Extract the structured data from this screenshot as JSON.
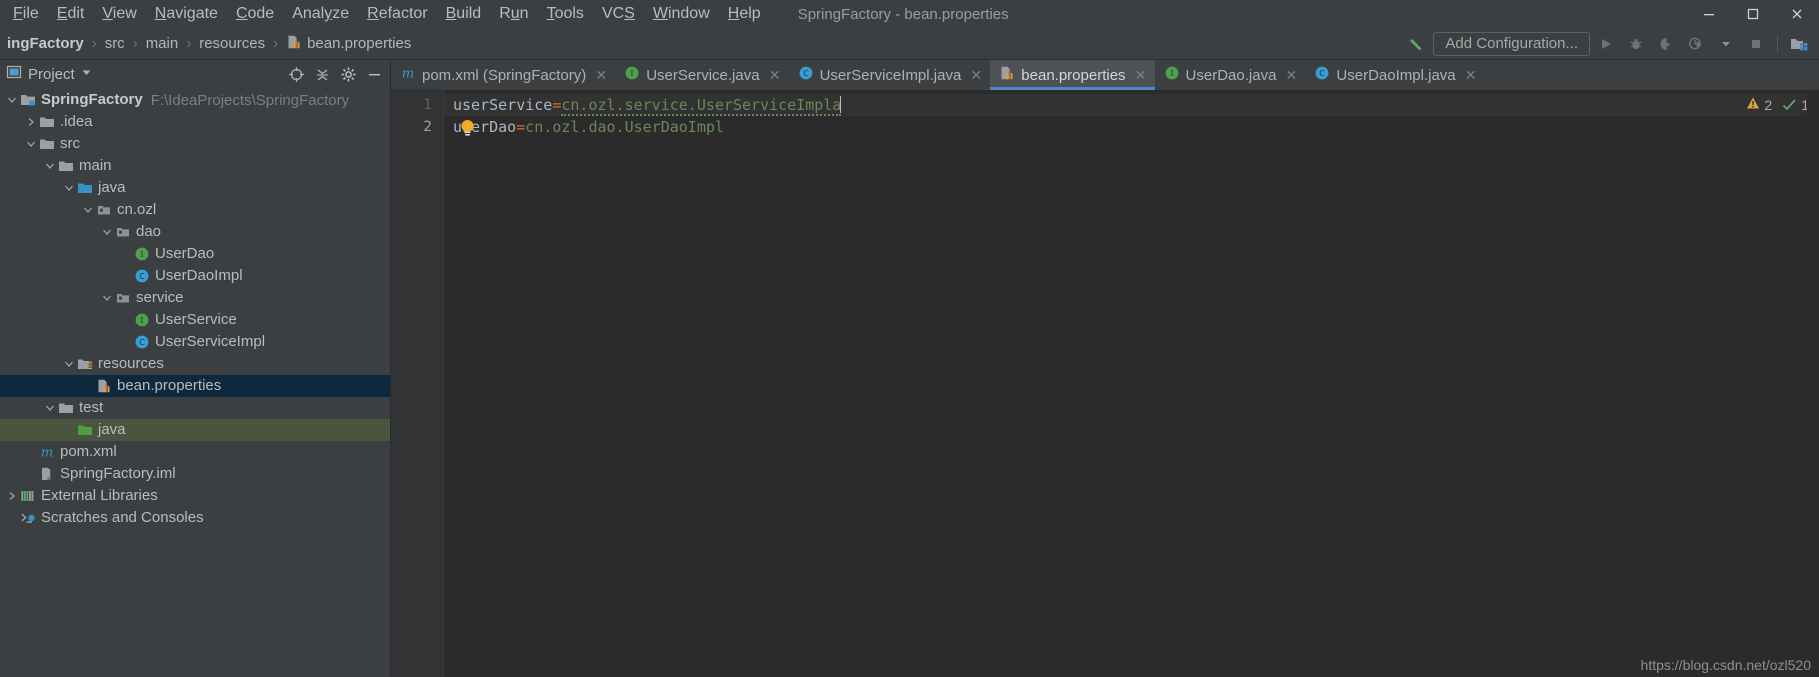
{
  "window": {
    "title": "SpringFactory - bean.properties",
    "menu": [
      "File",
      "Edit",
      "View",
      "Navigate",
      "Code",
      "Analyze",
      "Refactor",
      "Build",
      "Run",
      "Tools",
      "VCS",
      "Window",
      "Help"
    ],
    "controls": [
      "minimize",
      "maximize",
      "close"
    ]
  },
  "navbar": {
    "breadcrumbs": [
      {
        "label": "ingFactory",
        "icon": "",
        "bold": true
      },
      {
        "label": "src",
        "icon": ""
      },
      {
        "label": "main",
        "icon": ""
      },
      {
        "label": "resources",
        "icon": ""
      },
      {
        "label": "bean.properties",
        "icon": "properties-file-icon"
      }
    ],
    "separator": "›",
    "hammer_icon": "build-hammer-icon",
    "add_configuration": "Add Configuration...",
    "right_icons": [
      "run-icon",
      "debug-icon",
      "run-coverage-icon",
      "profiler-icon",
      "dropdown-icon",
      "stop-icon",
      "project-structure-icon"
    ]
  },
  "project_panel": {
    "title": "Project",
    "title_icon": "project-view-icon",
    "dropdown_icon": "chevron-down-icon",
    "header_icons": [
      "locate-target-icon",
      "collapse-all-icon",
      "settings-gear-icon",
      "hide-panel-icon"
    ],
    "tree": [
      {
        "label": "SpringFactory",
        "sublabel": "F:\\IdeaProjects\\SpringFactory",
        "indent": 0,
        "arrow": "down",
        "icon": "module-folder-icon",
        "bold": true,
        "state": "normal"
      },
      {
        "label": ".idea",
        "sublabel": "",
        "indent": 1,
        "arrow": "right",
        "icon": "folder-icon",
        "bold": false,
        "state": "normal"
      },
      {
        "label": "src",
        "sublabel": "",
        "indent": 1,
        "arrow": "down",
        "icon": "folder-icon",
        "bold": false,
        "state": "normal"
      },
      {
        "label": "main",
        "sublabel": "",
        "indent": 2,
        "arrow": "down",
        "icon": "folder-icon",
        "bold": false,
        "state": "normal"
      },
      {
        "label": "java",
        "sublabel": "",
        "indent": 3,
        "arrow": "down",
        "icon": "source-folder-icon",
        "bold": false,
        "state": "normal"
      },
      {
        "label": "cn.ozl",
        "sublabel": "",
        "indent": 4,
        "arrow": "down",
        "icon": "package-icon",
        "bold": false,
        "state": "normal"
      },
      {
        "label": "dao",
        "sublabel": "",
        "indent": 5,
        "arrow": "down",
        "icon": "package-icon",
        "bold": false,
        "state": "normal"
      },
      {
        "label": "UserDao",
        "sublabel": "",
        "indent": 6,
        "arrow": "none",
        "icon": "interface-icon",
        "bold": false,
        "state": "normal"
      },
      {
        "label": "UserDaoImpl",
        "sublabel": "",
        "indent": 6,
        "arrow": "none",
        "icon": "class-icon",
        "bold": false,
        "state": "normal"
      },
      {
        "label": "service",
        "sublabel": "",
        "indent": 5,
        "arrow": "down",
        "icon": "package-icon",
        "bold": false,
        "state": "normal"
      },
      {
        "label": "UserService",
        "sublabel": "",
        "indent": 6,
        "arrow": "none",
        "icon": "interface-icon",
        "bold": false,
        "state": "normal"
      },
      {
        "label": "UserServiceImpl",
        "sublabel": "",
        "indent": 6,
        "arrow": "none",
        "icon": "class-icon",
        "bold": false,
        "state": "normal"
      },
      {
        "label": "resources",
        "sublabel": "",
        "indent": 3,
        "arrow": "down",
        "icon": "resources-folder-icon",
        "bold": false,
        "state": "normal"
      },
      {
        "label": "bean.properties",
        "sublabel": "",
        "indent": 4,
        "arrow": "none",
        "icon": "properties-file-icon",
        "bold": false,
        "state": "selected"
      },
      {
        "label": "test",
        "sublabel": "",
        "indent": 2,
        "arrow": "down",
        "icon": "folder-icon",
        "bold": false,
        "state": "normal"
      },
      {
        "label": "java",
        "sublabel": "",
        "indent": 3,
        "arrow": "none",
        "icon": "test-source-folder-icon",
        "bold": false,
        "state": "green"
      },
      {
        "label": "pom.xml",
        "sublabel": "",
        "indent": 1,
        "arrow": "none",
        "icon": "maven-icon",
        "bold": false,
        "state": "normal"
      },
      {
        "label": "SpringFactory.iml",
        "sublabel": "",
        "indent": 1,
        "arrow": "none",
        "icon": "iml-file-icon",
        "bold": false,
        "state": "normal"
      },
      {
        "label": "External Libraries",
        "sublabel": "",
        "indent": 0,
        "arrow": "right",
        "icon": "libraries-icon",
        "bold": false,
        "state": "normal"
      },
      {
        "label": "Scratches and Consoles",
        "sublabel": "",
        "indent": 0,
        "arrow": "none",
        "icon": "scratches-icon",
        "bold": false,
        "state": "normal"
      }
    ]
  },
  "editor": {
    "tabs": [
      {
        "label": "pom.xml (SpringFactory)",
        "icon": "maven-icon",
        "active": false
      },
      {
        "label": "UserService.java",
        "icon": "interface-icon",
        "active": false
      },
      {
        "label": "UserServiceImpl.java",
        "icon": "class-icon",
        "active": false
      },
      {
        "label": "bean.properties",
        "icon": "properties-file-icon",
        "active": true
      },
      {
        "label": "UserDao.java",
        "icon": "interface-icon",
        "active": false
      },
      {
        "label": "UserDaoImpl.java",
        "icon": "class-icon",
        "active": false
      }
    ],
    "close_glyph": "✕",
    "lines": [
      {
        "number": "1",
        "key": "userDao",
        "sep": "=",
        "value": "cn.ozl.dao.UserDaoImpl",
        "current": false,
        "bulb": true,
        "caret": false,
        "squiggle": false
      },
      {
        "number": "2",
        "key": "userService",
        "sep": "=",
        "value": "cn.ozl.service.UserServiceImpla",
        "current": true,
        "bulb": false,
        "caret": true,
        "squiggle": true
      }
    ],
    "inspections": {
      "warning_icon": "warning-triangle-icon",
      "warning_count": "2",
      "ok_icon": "inspection-check-icon",
      "ok_count": "1"
    }
  },
  "watermark": "https://blog.csdn.net/ozl520"
}
